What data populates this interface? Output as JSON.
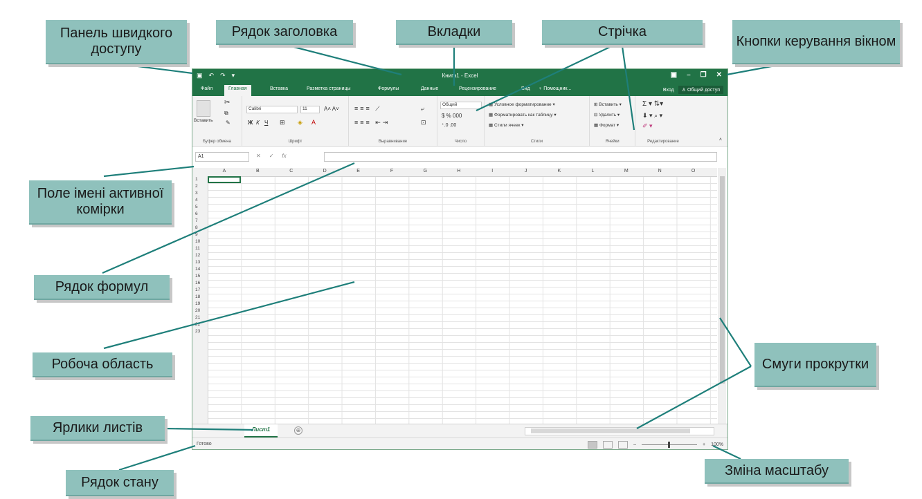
{
  "callouts": {
    "qat": "Панель швидкого доступу",
    "titlebar": "Рядок заголовка",
    "tabs": "Вкладки",
    "ribbon": "Стрічка",
    "window_controls": "Кнопки керування вікном",
    "name_box": "Поле імені активної комірки",
    "formula_bar": "Рядок формул",
    "workspace": "Робоча область",
    "scrollbars": "Смуги прокрутки",
    "sheet_tabs": "Ярлики листів",
    "zoom": "Зміна масштабу",
    "status_bar": "Рядок стану"
  },
  "excel": {
    "title": "Книга1 - Excel",
    "qat_icons": [
      "save-icon",
      "undo-icon",
      "redo-icon",
      "customize-icon"
    ],
    "tabs": [
      "Файл",
      "Главная",
      "Вставка",
      "Разметка страницы",
      "Формулы",
      "Данные",
      "Рецензирование",
      "Вид",
      "♀ Помощник..."
    ],
    "active_tab": "Главная",
    "login": "Вход",
    "share": "Общий доступ",
    "ribbon": {
      "groups": [
        "Буфер обмена",
        "Шрифт",
        "Выравнивание",
        "Число",
        "Стили",
        "Ячейки",
        "Редактирование"
      ],
      "paste": "Вставить",
      "font_name": "Calibri",
      "font_size": "11",
      "bold": "Ж",
      "italic": "К",
      "underline": "Ч",
      "number_format": "Общий",
      "cond_format": "Условное форматирование",
      "format_table": "Форматировать как таблицу",
      "cell_styles": "Стили ячеек",
      "insert": "Вставить",
      "delete": "Удалить",
      "format": "Формат"
    },
    "name_box": "A1",
    "fx": "fx",
    "columns": [
      "A",
      "B",
      "C",
      "D",
      "E",
      "F",
      "G",
      "H",
      "I",
      "J",
      "K",
      "L",
      "M",
      "N",
      "O"
    ],
    "rows": [
      "1",
      "2",
      "3",
      "4",
      "5",
      "6",
      "7",
      "8",
      "9",
      "10",
      "11",
      "12",
      "13",
      "14",
      "15",
      "16",
      "17",
      "18",
      "19",
      "20",
      "21",
      "22",
      "23"
    ],
    "sheet_tab": "Лист1",
    "add_sheet": "⊕",
    "status": "Готово",
    "zoom_level": "100%"
  },
  "colors": {
    "excel_green": "#217346",
    "callout_bg": "#8fc1bc",
    "line": "#1e7f7a"
  }
}
